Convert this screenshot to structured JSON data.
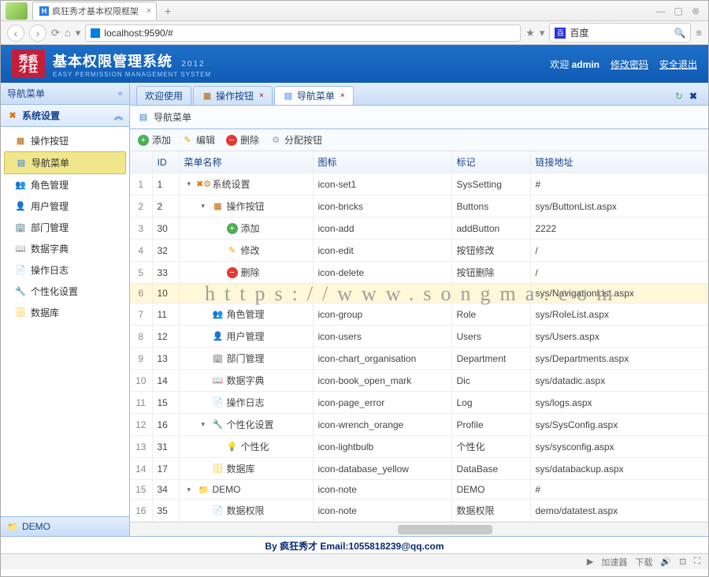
{
  "browser": {
    "tab_title": "疯狂秀才基本权限框架",
    "new_tab": "+",
    "url": "localhost:9590/#",
    "star": "★",
    "search_engine": "百度",
    "status_items": [
      "加速器",
      "下载"
    ]
  },
  "header": {
    "logo_line1": "秀疯",
    "logo_line2": "才狂",
    "title": "基本权限管理系统",
    "year": "2012",
    "subtitle": "EASY PERMISSION MANAGEMENT SYSTEM",
    "welcome": "欢迎",
    "user": "admin",
    "change_pwd": "修改密码",
    "logout": "安全退出"
  },
  "sidebar": {
    "title": "导航菜单",
    "section": "系统设置",
    "items": [
      {
        "label": "操作按钮",
        "icon": "bricks"
      },
      {
        "label": "导航菜单",
        "icon": "nav",
        "selected": true
      },
      {
        "label": "角色管理",
        "icon": "role"
      },
      {
        "label": "用户管理",
        "icon": "user"
      },
      {
        "label": "部门管理",
        "icon": "dept"
      },
      {
        "label": "数据字典",
        "icon": "dict"
      },
      {
        "label": "操作日志",
        "icon": "log"
      },
      {
        "label": "个性化设置",
        "icon": "wrench"
      },
      {
        "label": "数据库",
        "icon": "db"
      }
    ],
    "footer_section": "DEMO"
  },
  "tabs": [
    {
      "label": "欢迎使用",
      "icon": "",
      "closable": false
    },
    {
      "label": "操作按钮",
      "icon": "bricks",
      "closable": true
    },
    {
      "label": "导航菜单",
      "icon": "nav",
      "closable": true,
      "active": true
    }
  ],
  "content_title": "导航菜单",
  "toolbar": {
    "add": "添加",
    "edit": "编辑",
    "delete": "删除",
    "assign": "分配按钮"
  },
  "columns": {
    "rownum": "",
    "id": "ID",
    "name": "菜单名称",
    "icon": "图标",
    "mark": "标记",
    "link": "链接地址"
  },
  "rows": [
    {
      "n": 1,
      "id": "1",
      "name": "系统设置",
      "icon": "icon-set1",
      "mark": "SysSetting",
      "link": "#",
      "depth": 0,
      "ic": "gear",
      "exp": "▾"
    },
    {
      "n": 2,
      "id": "2",
      "name": "操作按钮",
      "icon": "icon-bricks",
      "mark": "Buttons",
      "link": "sys/ButtonList.aspx",
      "depth": 1,
      "ic": "bricks",
      "exp": "▾"
    },
    {
      "n": 3,
      "id": "30",
      "name": "添加",
      "icon": "icon-add",
      "mark": "addButton",
      "link": "2222",
      "depth": 2,
      "ic": "add"
    },
    {
      "n": 4,
      "id": "32",
      "name": "修改",
      "icon": "icon-edit",
      "mark": "按钮修改",
      "link": "/",
      "depth": 2,
      "ic": "edit"
    },
    {
      "n": 5,
      "id": "33",
      "name": "删除",
      "icon": "icon-delete",
      "mark": "按钮删除",
      "link": "/",
      "depth": 2,
      "ic": "del"
    },
    {
      "n": 6,
      "id": "10",
      "name": "",
      "icon": "",
      "mark": "",
      "link": "sys/NavigationList.aspx",
      "depth": 1,
      "ic": "",
      "selected": true
    },
    {
      "n": 7,
      "id": "11",
      "name": "角色管理",
      "icon": "icon-group",
      "mark": "Role",
      "link": "sys/RoleList.aspx",
      "depth": 1,
      "ic": "role"
    },
    {
      "n": 8,
      "id": "12",
      "name": "用户管理",
      "icon": "icon-users",
      "mark": "Users",
      "link": "sys/Users.aspx",
      "depth": 1,
      "ic": "user"
    },
    {
      "n": 9,
      "id": "13",
      "name": "部门管理",
      "icon": "icon-chart_organisation",
      "mark": "Department",
      "link": "sys/Departments.aspx",
      "depth": 1,
      "ic": "dept"
    },
    {
      "n": 10,
      "id": "14",
      "name": "数据字典",
      "icon": "icon-book_open_mark",
      "mark": "Dic",
      "link": "sys/datadic.aspx",
      "depth": 1,
      "ic": "dict"
    },
    {
      "n": 11,
      "id": "15",
      "name": "操作日志",
      "icon": "icon-page_error",
      "mark": "Log",
      "link": "sys/logs.aspx",
      "depth": 1,
      "ic": "log"
    },
    {
      "n": 12,
      "id": "16",
      "name": "个性化设置",
      "icon": "icon-wrench_orange",
      "mark": "Profile",
      "link": "sys/SysConfig.aspx",
      "depth": 1,
      "ic": "wrench",
      "exp": "▾"
    },
    {
      "n": 13,
      "id": "31",
      "name": "个性化",
      "icon": "icon-lightbulb",
      "mark": "个性化",
      "link": "sys/sysconfig.aspx",
      "depth": 2,
      "ic": "bulb"
    },
    {
      "n": 14,
      "id": "17",
      "name": "数据库",
      "icon": "icon-database_yellow",
      "mark": "DataBase",
      "link": "sys/databackup.aspx",
      "depth": 1,
      "ic": "db"
    },
    {
      "n": 15,
      "id": "34",
      "name": "DEMO",
      "icon": "icon-note",
      "mark": "DEMO",
      "link": "#",
      "depth": 0,
      "ic": "folder",
      "exp": "▾"
    },
    {
      "n": 16,
      "id": "35",
      "name": "数据权限",
      "icon": "icon-note",
      "mark": "数据权限",
      "link": "demo/datatest.aspx",
      "depth": 1,
      "ic": "note"
    }
  ],
  "watermark": "https://www.songma.com",
  "footer": "By 疯狂秀才 Email:1055818239@qq.com",
  "icon_glyphs": {
    "gear": "✖⚙",
    "bricks": "▦",
    "nav": "▤",
    "role": "👥",
    "user": "👤",
    "dept": "🏢",
    "dict": "📖",
    "log": "📄",
    "wrench": "🔧",
    "bulb": "💡",
    "db": "🗄",
    "folder": "📁",
    "add": "+",
    "edit": "✎",
    "del": "−",
    "assign": "⚙",
    "note": "📄"
  }
}
